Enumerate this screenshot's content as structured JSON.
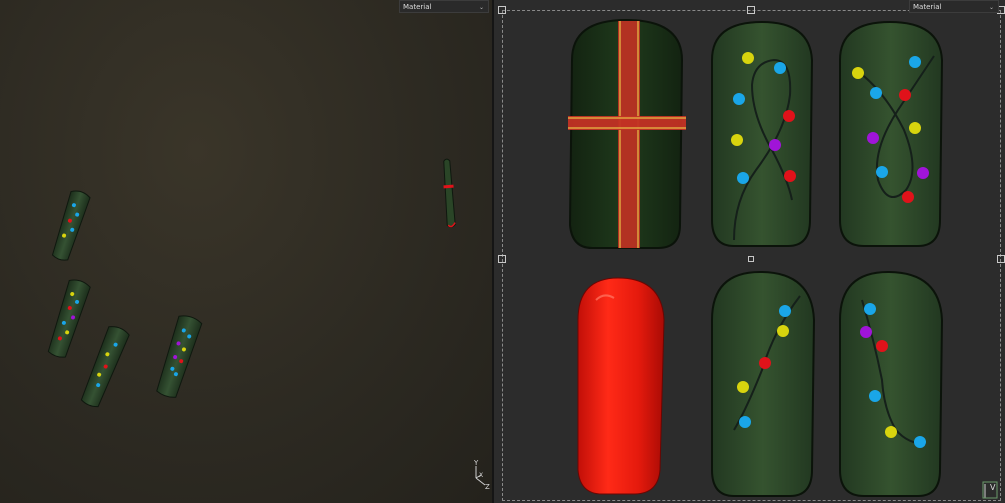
{
  "left_viewport": {
    "shading_mode": "Material",
    "axes": {
      "y": "Y",
      "x": "X",
      "z": "Z"
    }
  },
  "right_viewport": {
    "shading_mode": "Material",
    "axis": {
      "v": "V"
    }
  },
  "colors": {
    "nail_green": "#2f4a2c",
    "nail_green_dark": "#1a2a19",
    "nail_red": "#e81a0c",
    "ribbon_red": "#c23224",
    "ribbon_gold": "#e0a640",
    "wire": "#15201a",
    "bulb_blue": "#1aa6e8",
    "bulb_yellow": "#d8d40e",
    "bulb_red": "#e0121a",
    "bulb_purple": "#a014d8",
    "left_bg": "#2e2b23",
    "right_bg": "#2c2c2c"
  },
  "icons": [
    "chevron-down-icon",
    "axis-gizmo-icon",
    "uv-axis-icon",
    "selection-handle-icon"
  ]
}
